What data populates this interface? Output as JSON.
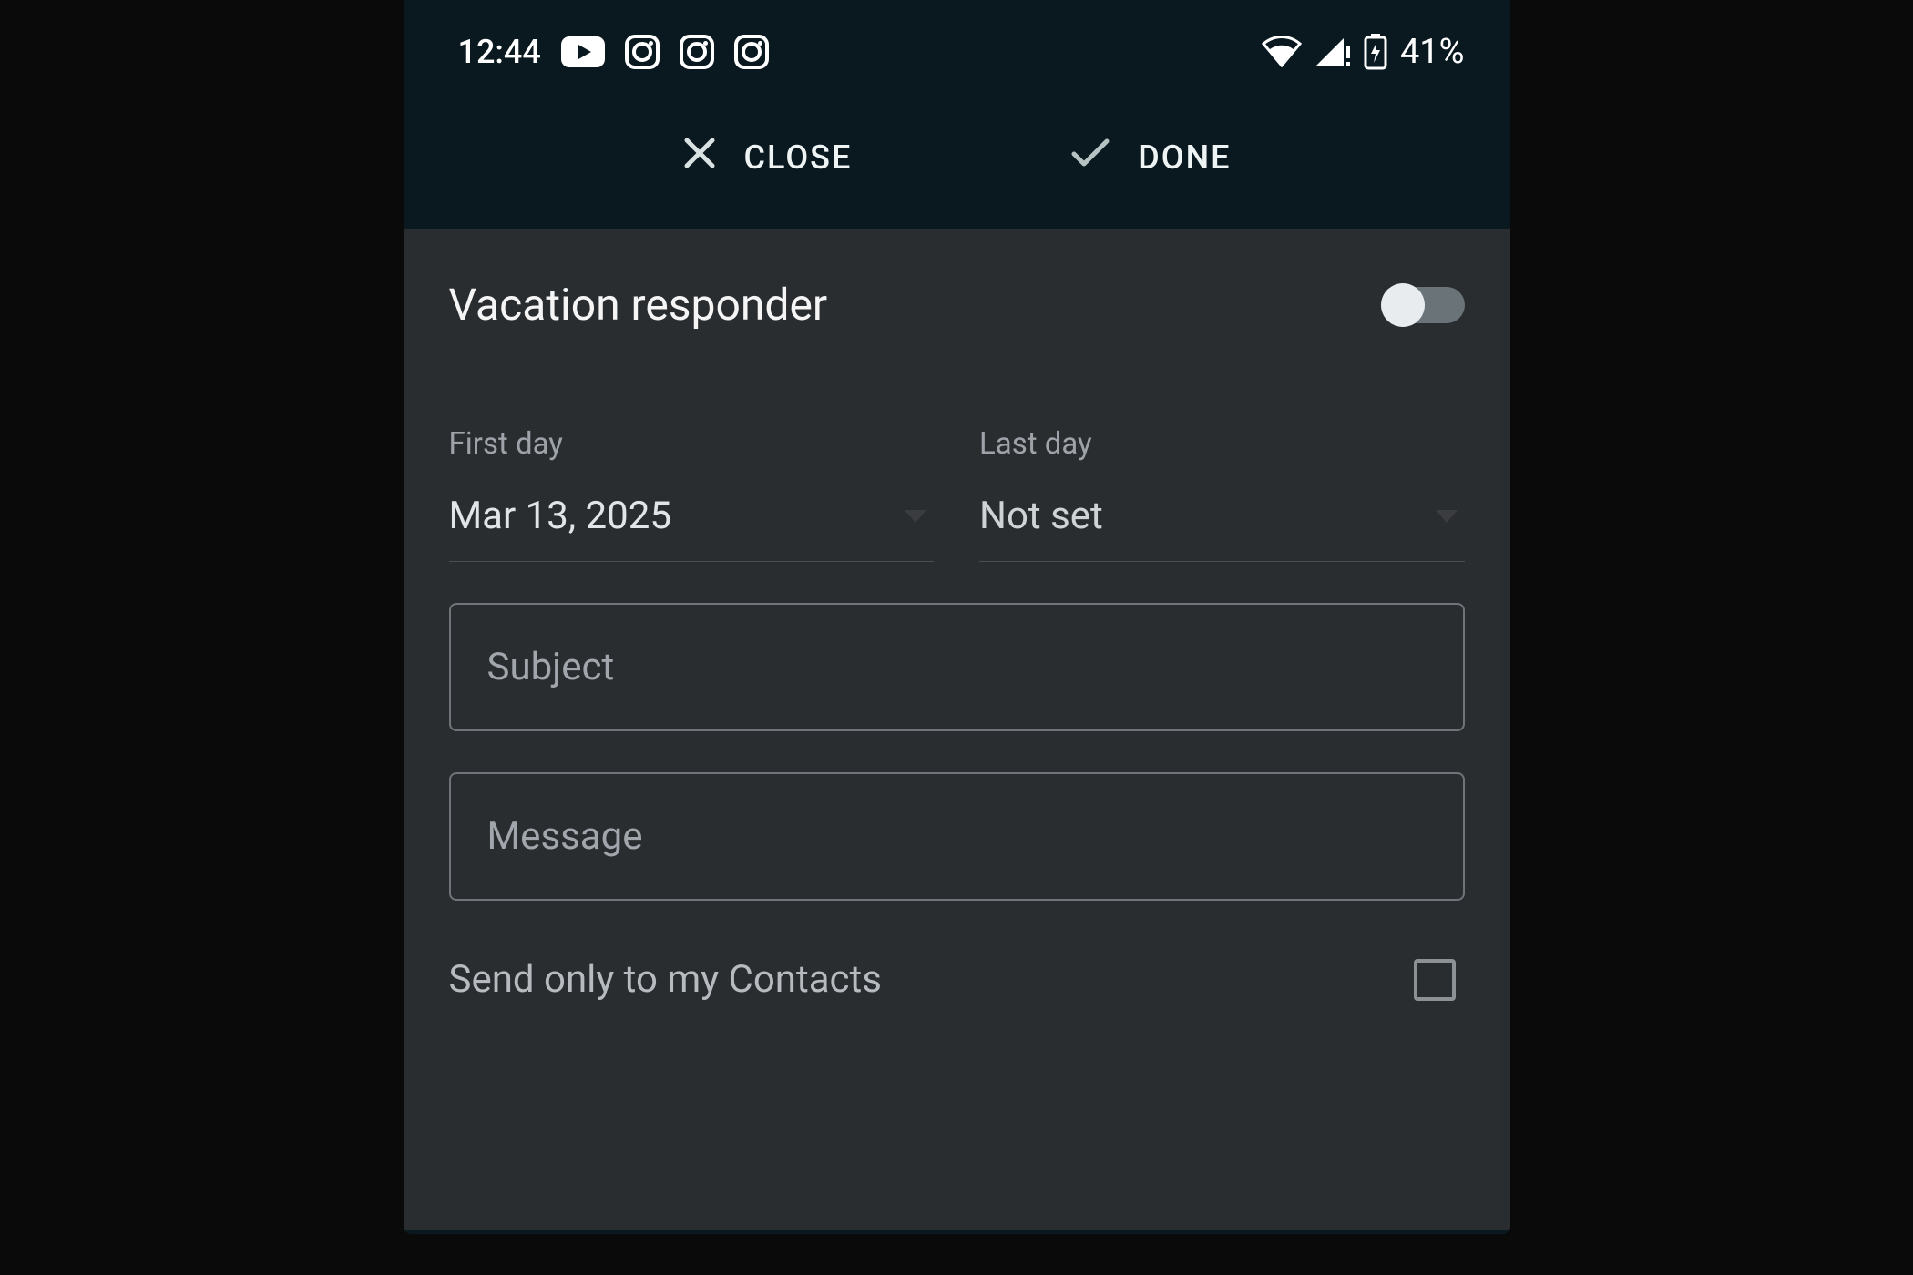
{
  "status": {
    "time": "12:44",
    "battery": "41%"
  },
  "actions": {
    "close": "CLOSE",
    "done": "DONE"
  },
  "page": {
    "title": "Vacation responder"
  },
  "dates": {
    "first_label": "First day",
    "first_value": "Mar 13, 2025",
    "last_label": "Last day",
    "last_value": "Not set"
  },
  "inputs": {
    "subject_placeholder": "Subject",
    "message_placeholder": "Message"
  },
  "contacts": {
    "label": "Send only to my Contacts"
  }
}
